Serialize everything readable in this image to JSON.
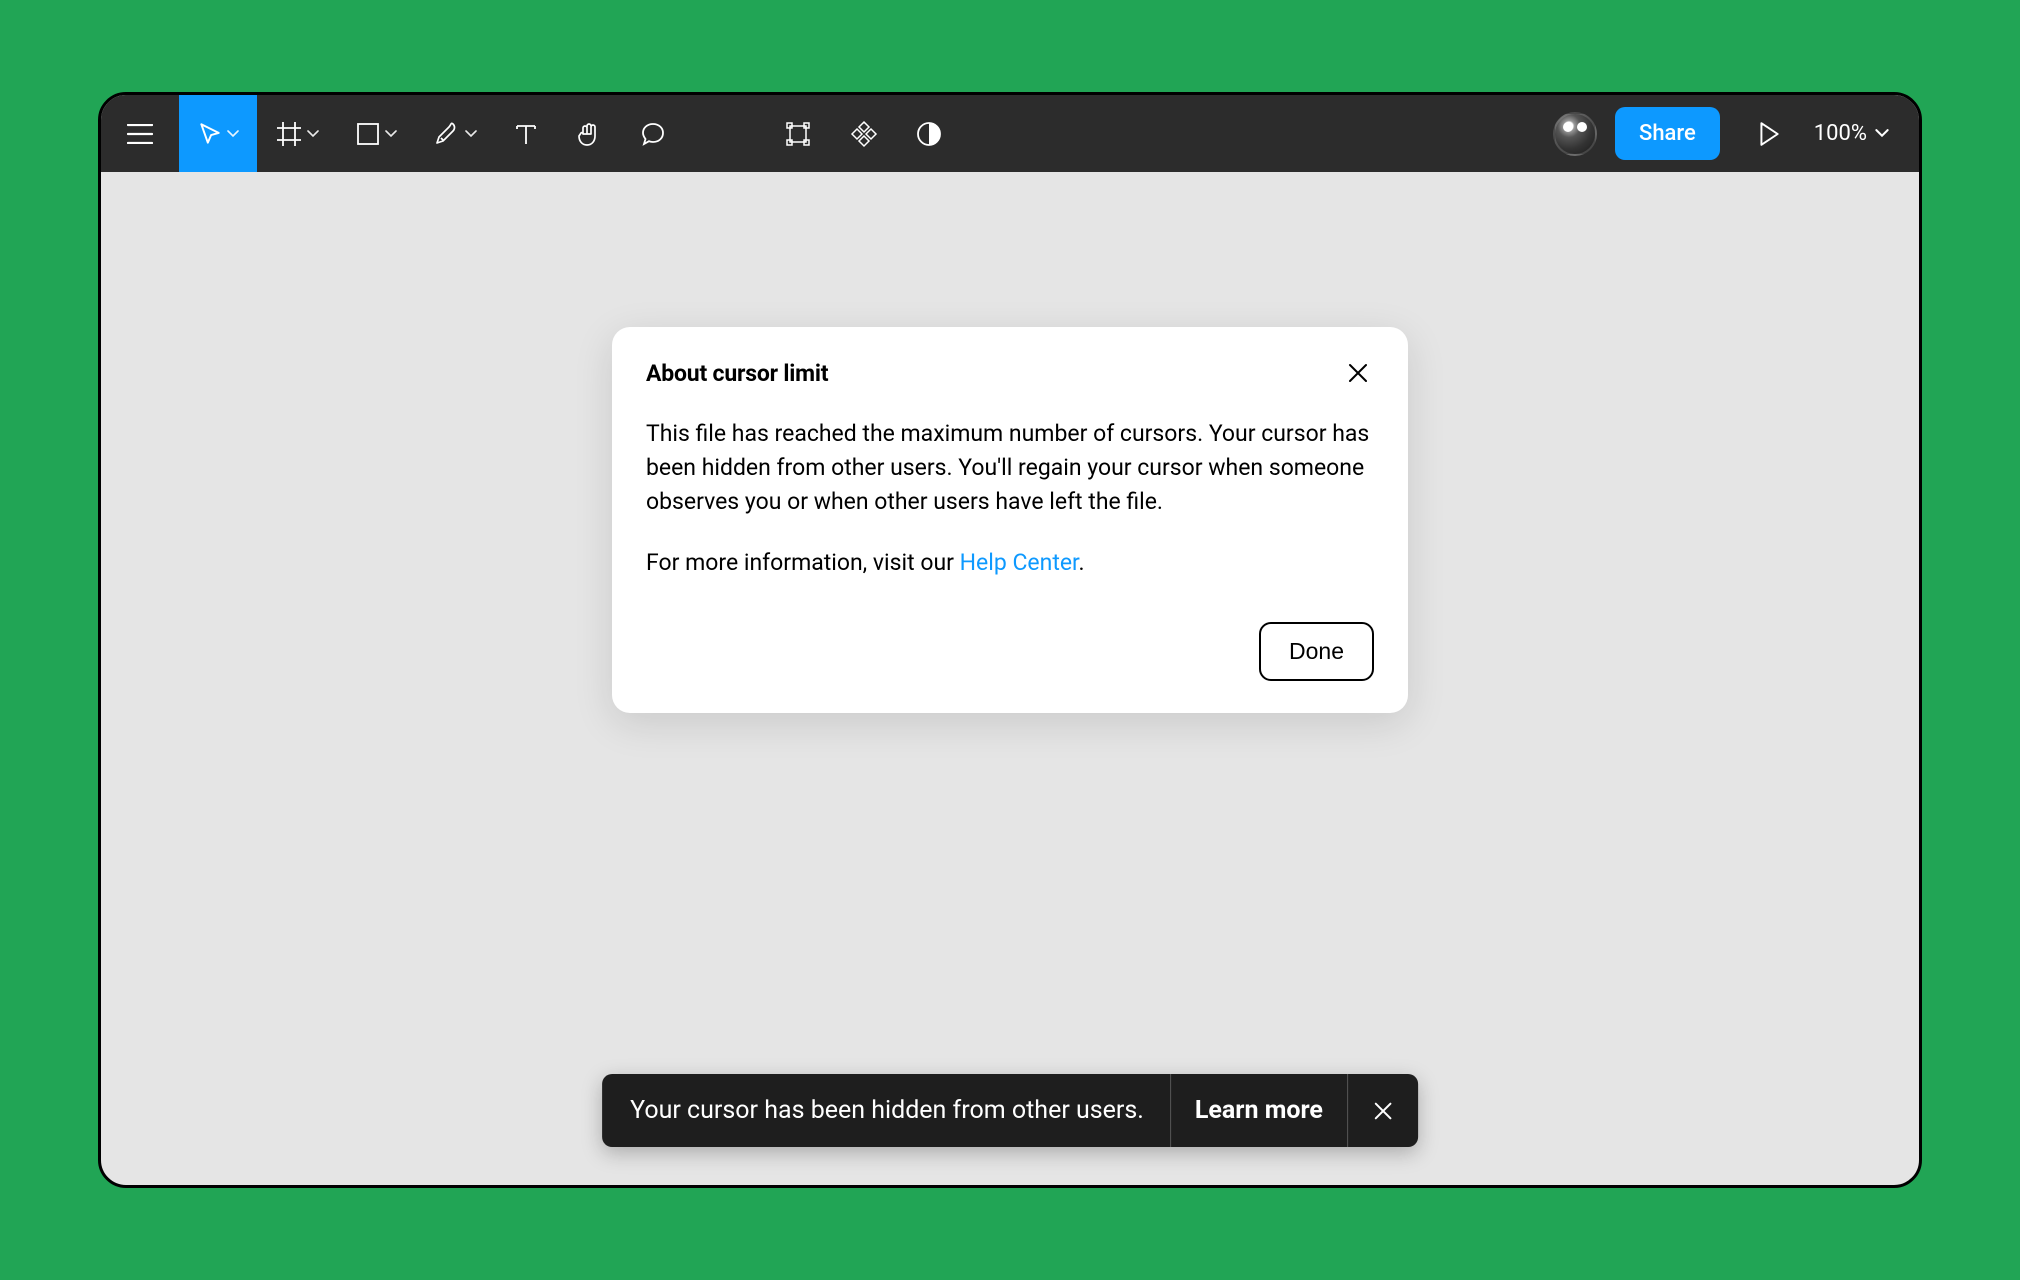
{
  "toolbar": {
    "share_label": "Share",
    "zoom_level": "100%"
  },
  "modal": {
    "title": "About cursor limit",
    "body_p1": "This file has reached the maximum number of cursors. Your cursor has been hidden from other users. You'll regain your cursor when someone observes you or when other users have left the file.",
    "body_p2_prefix": "For more information, visit our ",
    "body_p2_link": "Help Center",
    "body_p2_suffix": ".",
    "done_label": "Done"
  },
  "toast": {
    "message": "Your cursor has been hidden from other users.",
    "action_label": "Learn more"
  },
  "colors": {
    "accent": "#0d99ff",
    "bg_page": "#21a555",
    "toolbar": "#2c2c2c",
    "canvas": "#e5e5e5"
  }
}
